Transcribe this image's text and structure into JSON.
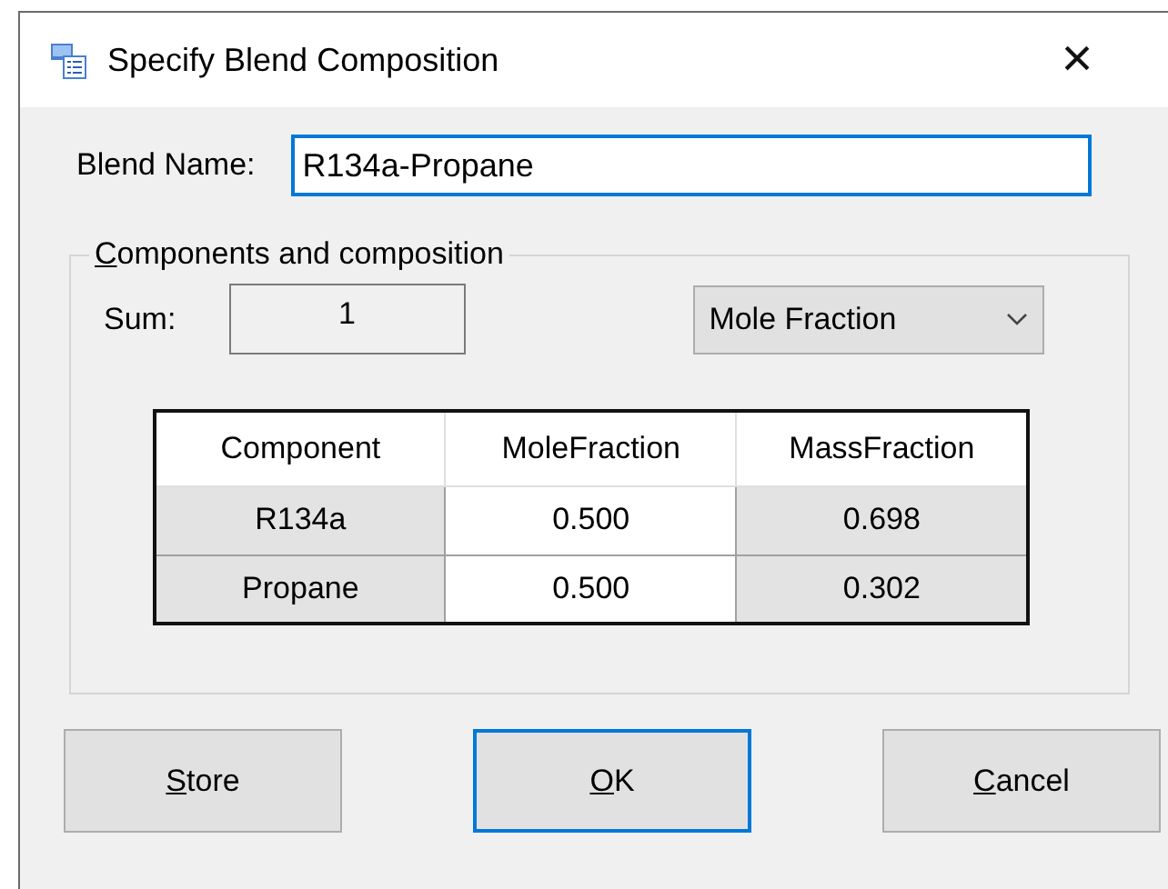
{
  "window": {
    "title": "Specify Blend Composition",
    "close": "×"
  },
  "blend_name": {
    "label": "Blend Name:",
    "value": "R134a-Propane",
    "focused": true
  },
  "group": {
    "title": "Components and composition",
    "mnemonic": true
  },
  "sum": {
    "label": "Sum:",
    "value": "1"
  },
  "basis_dropdown": {
    "value": "Mole Fraction"
  },
  "table": {
    "columns": [
      {
        "label": "Component",
        "editable": false
      },
      {
        "label": "MoleFraction",
        "editable": true
      },
      {
        "label": "MassFraction",
        "editable": false
      }
    ],
    "rows": [
      [
        "R134a",
        "0.500",
        "0.698"
      ],
      [
        "Propane",
        "0.500",
        "0.302"
      ]
    ]
  },
  "buttons": [
    {
      "label": "Store",
      "mnemonic": true,
      "focused": false
    },
    {
      "label": "OK",
      "mnemonic": true,
      "focused": true
    },
    {
      "label": "Cancel",
      "mnemonic": true,
      "focused": false
    }
  ]
}
